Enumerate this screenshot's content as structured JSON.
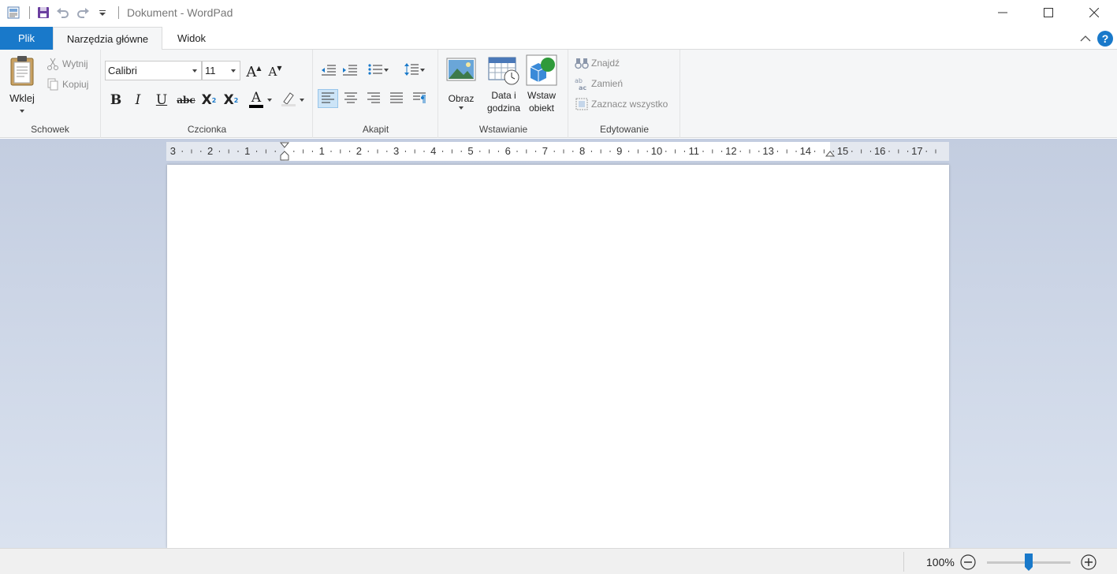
{
  "window": {
    "title": "Dokument - WordPad",
    "separator": "|"
  },
  "tabs": {
    "file": "Plik",
    "home": "Narzędzia główne",
    "view": "Widok"
  },
  "help": {
    "label": "?"
  },
  "clipboard": {
    "group_label": "Schowek",
    "paste": "Wklej",
    "cut": "Wytnij",
    "copy": "Kopiuj"
  },
  "font": {
    "group_label": "Czcionka",
    "family": "Calibri",
    "size": "11",
    "bold": "B",
    "italic": "I",
    "underline": "U",
    "strikethrough": "abc",
    "subscript": "X",
    "superscript": "X",
    "grow": "A",
    "shrink": "A",
    "color": "A",
    "text_color_hex": "#000000"
  },
  "paragraph": {
    "group_label": "Akapit",
    "alignment_selected": "left"
  },
  "insert": {
    "group_label": "Wstawianie",
    "picture": "Obraz",
    "datetime_line1": "Data i",
    "datetime_line2": "godzina",
    "object_line1": "Wstaw",
    "object_line2": "obiekt"
  },
  "editing": {
    "group_label": "Edytowanie",
    "find": "Znajdź",
    "replace": "Zamień",
    "select_all": "Zaznacz wszystko"
  },
  "ruler": {
    "numbers": [
      "3",
      "2",
      "1",
      "1",
      "2",
      "3",
      "4",
      "5",
      "6",
      "7",
      "8",
      "9",
      "10",
      "11",
      "12",
      "13",
      "14",
      "15",
      "16",
      "17"
    ]
  },
  "status": {
    "zoom": "100%",
    "zoom_out": "−",
    "zoom_in": "+",
    "zoom_level_percent": 100
  },
  "colors": {
    "accent": "#1979ca",
    "ribbon_bg": "#f5f6f7",
    "workspace_top": "#c3cde0",
    "workspace_bottom": "#dae2ef"
  }
}
